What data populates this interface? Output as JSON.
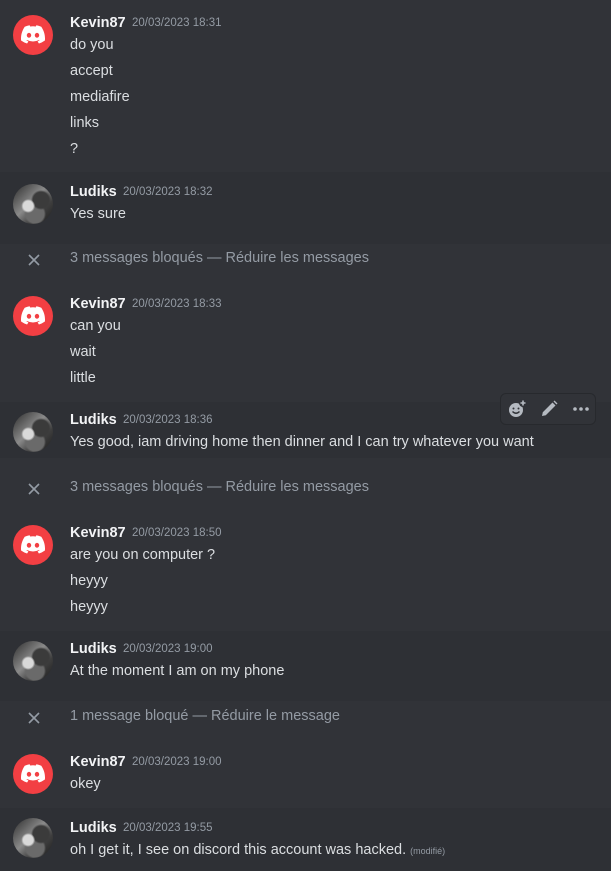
{
  "messages": [
    {
      "author": "Kevin87",
      "timestamp": "20/03/2023 18:31",
      "lines": [
        "do you",
        "accept",
        "mediafire",
        "links",
        "?"
      ]
    },
    {
      "author": "Ludiks",
      "timestamp": "20/03/2023 18:32",
      "lines": [
        "Yes sure"
      ]
    },
    {
      "author": "Kevin87",
      "timestamp": "20/03/2023 18:33",
      "lines": [
        "can you",
        "wait",
        "little"
      ]
    },
    {
      "author": "Ludiks",
      "timestamp": "20/03/2023 18:36",
      "lines": [
        "Yes good, iam driving home then dinner and I can try whatever you want"
      ]
    },
    {
      "author": "Kevin87",
      "timestamp": "20/03/2023 18:50",
      "lines": [
        "are you on computer ?",
        "heyyy",
        "heyyy"
      ]
    },
    {
      "author": "Ludiks",
      "timestamp": "20/03/2023 19:00",
      "lines": [
        "At the moment I am on my phone"
      ]
    },
    {
      "author": "Kevin87",
      "timestamp": "20/03/2023 19:00",
      "lines": [
        "okey"
      ]
    },
    {
      "author": "Ludiks",
      "timestamp": "20/03/2023 19:55",
      "lines": [
        "oh I get it, I see on discord this account was hacked."
      ],
      "edited": "(modifié)"
    }
  ],
  "blocked": [
    {
      "text": "3 messages bloqués",
      "separator": "—",
      "action": "Réduire les messages"
    },
    {
      "text": "3 messages bloqués",
      "separator": "—",
      "action": "Réduire les messages"
    },
    {
      "text": "1 message bloqué",
      "separator": "—",
      "action": "Réduire le message"
    }
  ],
  "toolbar": {
    "icons": [
      "add-reaction-icon",
      "edit-pencil-icon",
      "more-options-icon"
    ]
  },
  "colors": {
    "background": "#313338",
    "discord_red": "#f23f43",
    "muted": "#949ba4",
    "text": "#dbdee1"
  }
}
